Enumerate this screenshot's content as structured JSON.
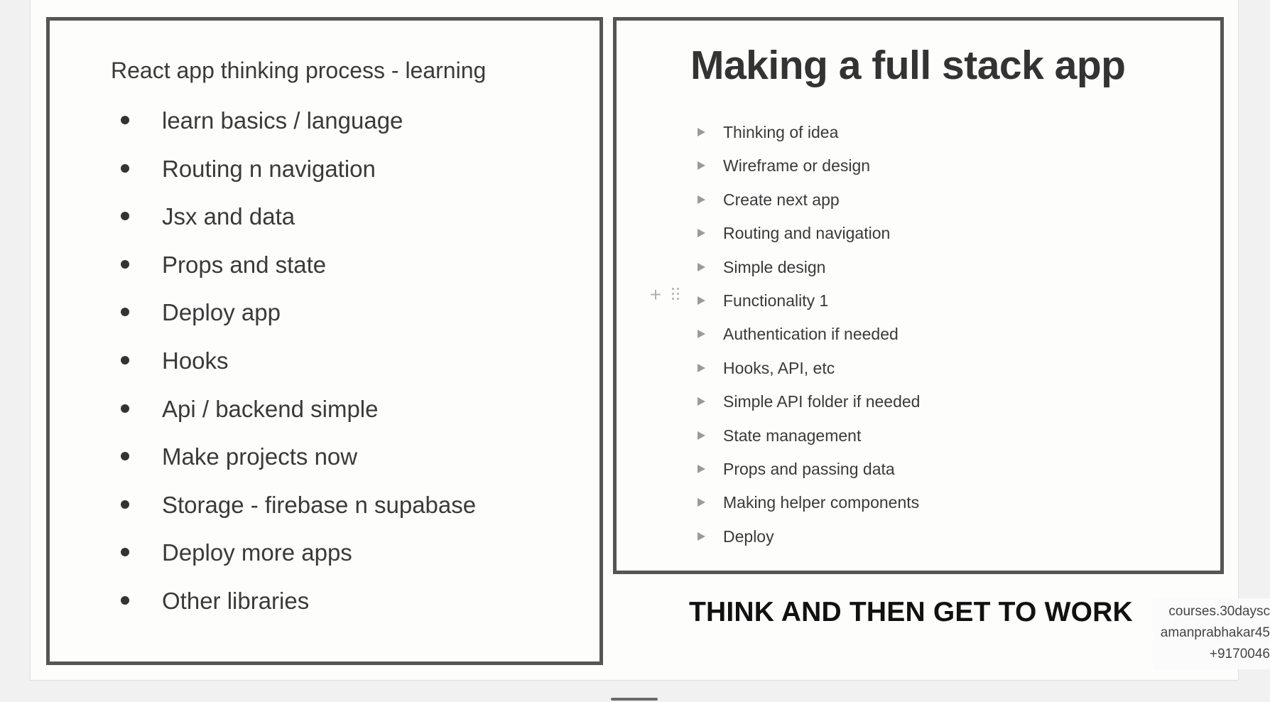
{
  "left_panel": {
    "title": "React app thinking process - learning",
    "items": [
      "learn basics / language",
      "Routing n navigation",
      "Jsx and data",
      "Props and state",
      "Deploy app",
      "Hooks",
      "Api / backend simple",
      "Make projects now",
      "Storage - firebase n supabase",
      "Deploy more apps",
      "Other libraries"
    ]
  },
  "right_panel": {
    "title": "Making a full stack app",
    "items": [
      "Thinking of idea",
      "Wireframe or design",
      "Create next app",
      "Routing and navigation",
      "Simple design",
      "Functionality 1",
      "Authentication if needed",
      "Hooks, API, etc",
      "Simple API folder if needed",
      "State management",
      "Props and passing data",
      "Making helper components",
      "Deploy"
    ]
  },
  "tagline": "THINK AND THEN GET TO WORK",
  "watermark": {
    "line1": "courses.30daysc",
    "line2": "amanprabhakar45",
    "line3": "+9170046"
  },
  "icons": {
    "add": "plus-icon",
    "drag": "drag-handle-icon",
    "toggle": "triangle-right-icon",
    "bullet": "bullet-dot-icon"
  },
  "colors": {
    "frame_border": "#555555",
    "text": "#3a3a3a",
    "toggle_arrow": "#9a9a9a",
    "tagline": "#111111"
  }
}
